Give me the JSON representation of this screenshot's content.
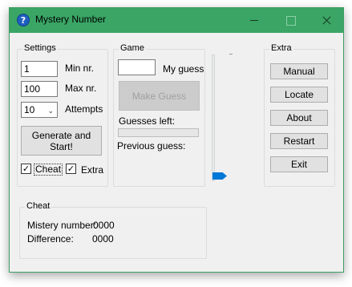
{
  "window": {
    "title": "Mystery Number",
    "icon": "question-icon",
    "icon_glyph": "?",
    "title_bar_color": "#3aa565"
  },
  "settings": {
    "legend": "Settings",
    "min_value": "1",
    "min_label": "Min nr.",
    "max_value": "100",
    "max_label": "Max nr.",
    "attempts_value": "10",
    "attempts_label": "Attempts",
    "generate_label": "Generate and Start!",
    "cheat_label": "Cheat",
    "cheat_checked": true,
    "extra_label": "Extra",
    "extra_checked": true,
    "check_glyph": "✓"
  },
  "game": {
    "legend": "Game",
    "guess_value": "",
    "guess_label": "My guess",
    "make_guess_label": "Make Guess",
    "guesses_left_label": "Guesses left:",
    "guesses_left_fraction": 0,
    "previous_guess_label": "Previous guess:"
  },
  "slider": {
    "level_fraction": 0
  },
  "extra": {
    "legend": "Extra",
    "buttons": [
      "Manual",
      "Locate",
      "About",
      "Restart",
      "Exit"
    ]
  },
  "cheat": {
    "legend": "Cheat",
    "mystery_label": "Mistery number:",
    "mystery_value": "0000",
    "difference_label": "Difference:",
    "difference_value": "0000"
  }
}
